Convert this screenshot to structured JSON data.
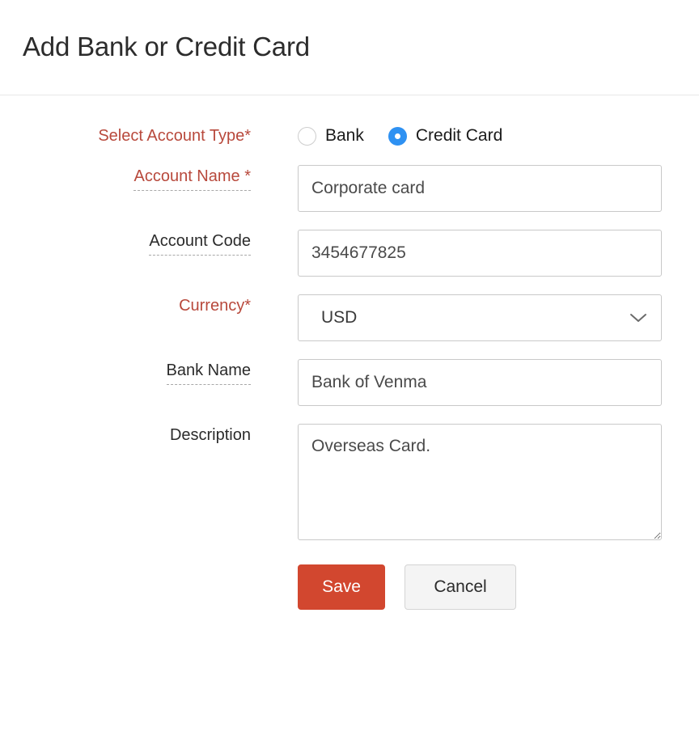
{
  "header": {
    "title": "Add Bank or Credit Card"
  },
  "form": {
    "account_type": {
      "label": "Select Account Type*",
      "options": [
        {
          "label": "Bank",
          "selected": false
        },
        {
          "label": "Credit Card",
          "selected": true
        }
      ]
    },
    "account_name": {
      "label": "Account Name *",
      "value": "Corporate card",
      "placeholder": ""
    },
    "account_code": {
      "label": "Account Code",
      "value": "3454677825",
      "placeholder": ""
    },
    "currency": {
      "label": "Currency*",
      "value": "USD",
      "icon": "chevron-down-icon"
    },
    "bank_name": {
      "label": "Bank Name",
      "value": "Bank of Venma",
      "placeholder": ""
    },
    "description": {
      "label": "Description",
      "value": "Overseas Card.",
      "placeholder": ""
    }
  },
  "actions": {
    "save_label": "Save",
    "cancel_label": "Cancel"
  },
  "colors": {
    "required_label": "#b8493c",
    "radio_selected": "#2e91f2",
    "primary_button": "#d2472f",
    "secondary_button": "#f4f4f4",
    "input_border": "#c9c9c9",
    "divider": "#e8e8e8"
  }
}
